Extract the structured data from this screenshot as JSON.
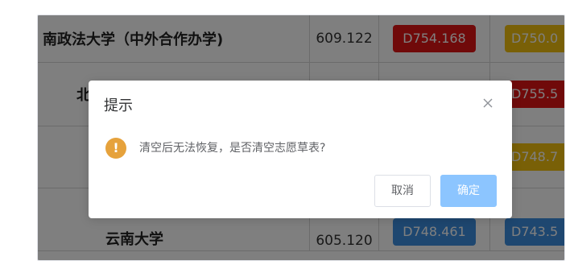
{
  "table": {
    "rows": [
      {
        "name": "南政法大学（中外合作办学)",
        "score": "609.122",
        "badge1": "D754.168",
        "badge1_color": "#e01515",
        "badge2": "D750.0",
        "badge2_color": "#f2c10f"
      },
      {
        "name": "北",
        "score": "",
        "badge1": "",
        "badge1_color": "#f2c10f",
        "badge2": "D755.5",
        "badge2_color": "#e01515"
      },
      {
        "name": "",
        "score": "",
        "badge1": "",
        "badge1_color": "",
        "badge2": "D748.7",
        "badge2_color": "#f2c10f"
      },
      {
        "name": "云南大学",
        "score": "605.120",
        "badge1": "D748.461",
        "badge1_color": "#3d8fe0",
        "badge2": "D743.5",
        "badge2_color": "#3d8fe0"
      }
    ]
  },
  "dialog": {
    "title": "提示",
    "close_icon": "close-icon",
    "warning_icon": "warning-icon",
    "warning_symbol": "!",
    "warning_color": "#e6a23c",
    "message": "清空后无法恢复，是否清空志愿草表?",
    "cancel_label": "取消",
    "confirm_label": "确定",
    "confirm_color": "#8cc5ff"
  }
}
